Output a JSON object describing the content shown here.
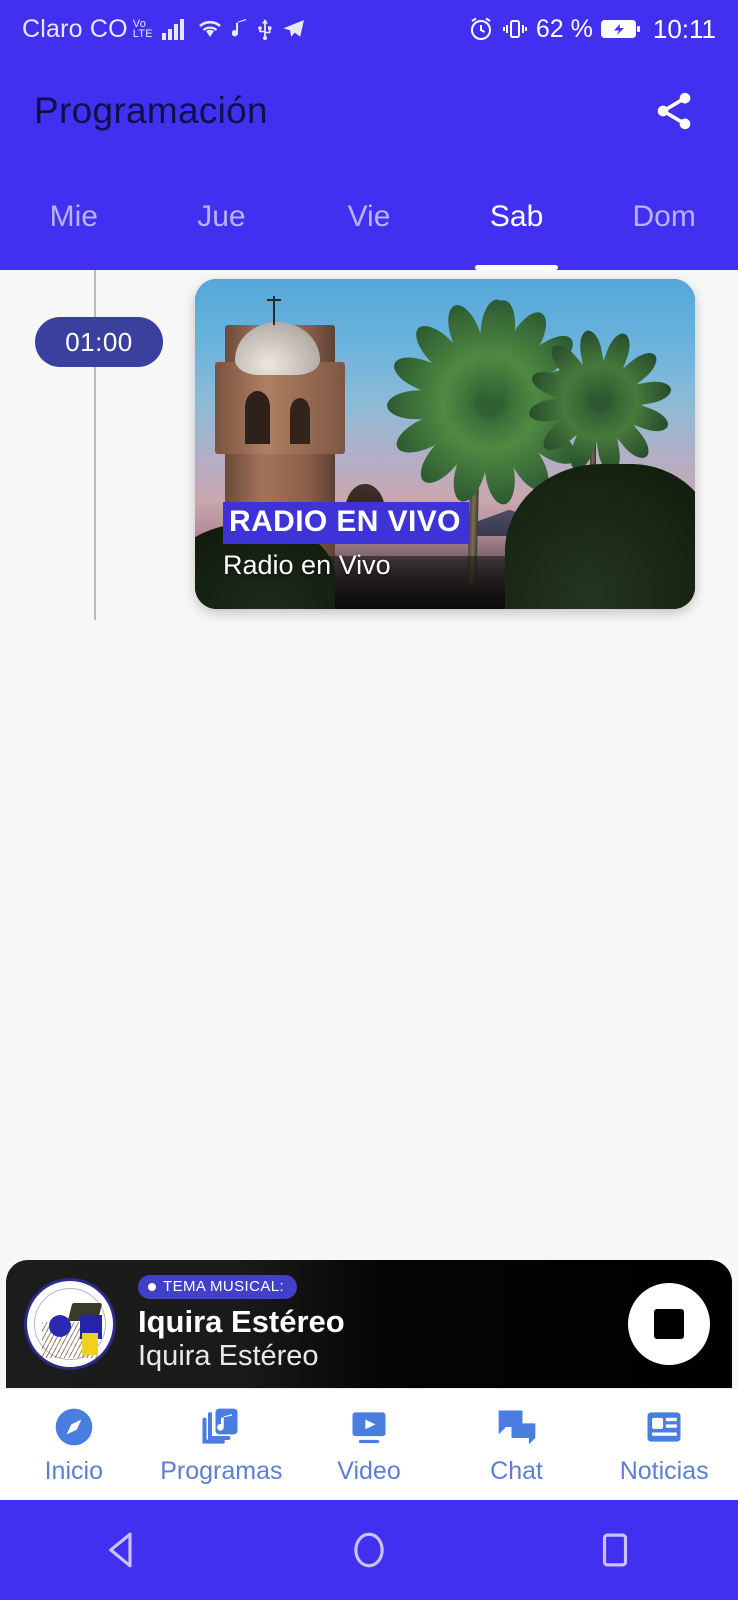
{
  "statusbar": {
    "carrier": "Claro CO",
    "volte_top": "Vo",
    "volte_bottom": "LTE",
    "battery_percent": "62 %",
    "time": "10:11",
    "icons": [
      "signal-icon",
      "wifi-icon",
      "music-note-icon",
      "usb-icon",
      "telegram-icon",
      "alarm-icon",
      "vibrate-icon",
      "battery-icon"
    ]
  },
  "appbar": {
    "title": "Programación",
    "share_label": "share-icon"
  },
  "tabs": {
    "items": [
      {
        "label": "Mie",
        "active": false
      },
      {
        "label": "Jue",
        "active": false
      },
      {
        "label": "Vie",
        "active": false
      },
      {
        "label": "Sab",
        "active": true
      },
      {
        "label": "Dom",
        "active": false
      }
    ]
  },
  "schedule": {
    "slots": [
      {
        "time": "01:00",
        "title": "RADIO EN VIVO",
        "subtitle": "Radio en Vivo"
      }
    ]
  },
  "player": {
    "badge_label": "TEMA MUSICAL:",
    "track_title": "Iquira Estéreo",
    "track_subtitle": "Iquira Estéreo",
    "stop_label": "stop-button"
  },
  "bottomnav": {
    "items": [
      {
        "label": "Inicio",
        "icon": "compass-icon"
      },
      {
        "label": "Programas",
        "icon": "music-library-icon"
      },
      {
        "label": "Video",
        "icon": "video-play-icon"
      },
      {
        "label": "Chat",
        "icon": "chat-bubbles-icon"
      },
      {
        "label": "Noticias",
        "icon": "news-article-icon"
      }
    ]
  },
  "androidnav": {
    "back": "back-triangle-icon",
    "home": "home-circle-icon",
    "recents": "recents-square-icon"
  },
  "colors": {
    "primary": "#4130f0",
    "accent": "#3d33d6",
    "pill": "#3b3f9e",
    "nav_text": "#5b7fd4",
    "background": "#f7f7f7"
  }
}
